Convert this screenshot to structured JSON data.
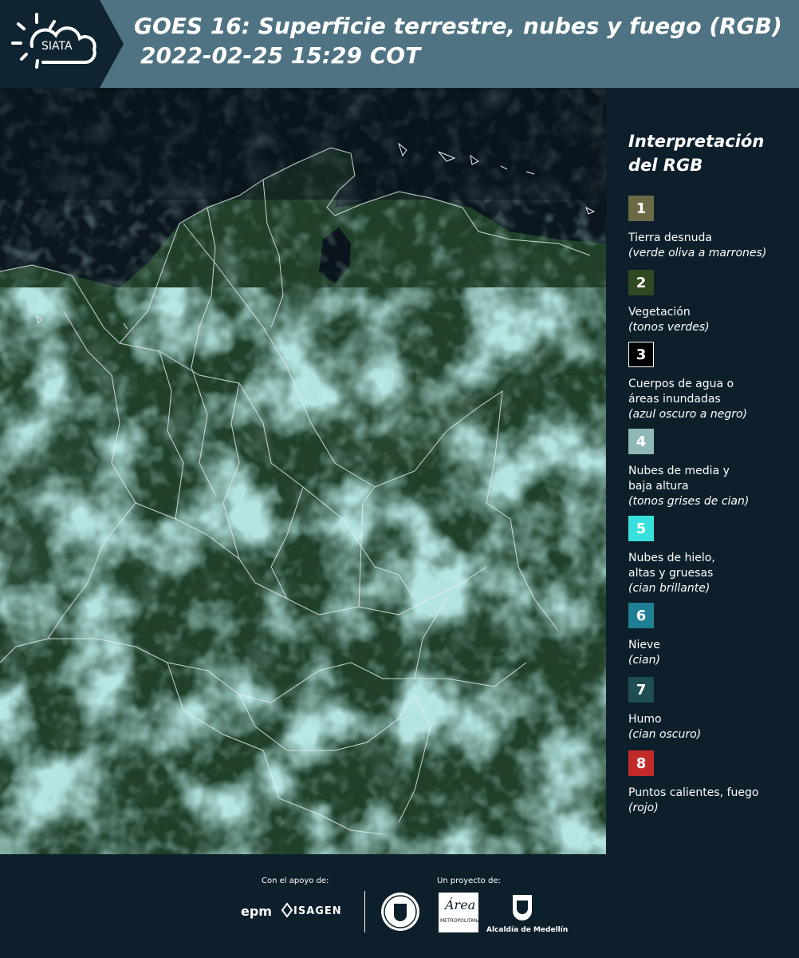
{
  "header": {
    "logo_text": "SIATA",
    "title_line1": "GOES 16: Superficie terrestre, nubes y fuego (RGB)",
    "title_line2": "2022-02-25 15:29 COT",
    "background_color": "#4f7382"
  },
  "legend": {
    "title_line1": "Interpretación",
    "title_line2": "del RGB",
    "items": [
      {
        "number": "1",
        "color": "#6b6a46",
        "label": "Tierra desnuda",
        "note": "(verde oliva a marrones)"
      },
      {
        "number": "2",
        "color": "#2f4a22",
        "label": "Vegetación",
        "note": "(tonos verdes)"
      },
      {
        "number": "3",
        "color": "#000000",
        "label": "Cuerpos de agua o áreas inundadas",
        "note": "(azul oscuro a negro)"
      },
      {
        "number": "4",
        "color": "#8fb8b6",
        "label": "Nubes de media y baja altura",
        "note": "(tonos grises de cian)"
      },
      {
        "number": "5",
        "color": "#37e0dc",
        "label": "Nubes de hielo, altas y gruesas",
        "note": "(cian brillante)"
      },
      {
        "number": "6",
        "color": "#1f7f94",
        "label": "Nieve",
        "note": "(cian)"
      },
      {
        "number": "7",
        "color": "#1e4e52",
        "label": "Humo",
        "note": "(cian oscuro)"
      },
      {
        "number": "8",
        "color": "#c22b2a",
        "label": "Puntos calientes, fuego",
        "note": "(rojo)"
      }
    ]
  },
  "footer": {
    "support_label": "Con el apoyo de:",
    "project_label": "Un proyecto de:",
    "sponsor_1": "epm",
    "sponsor_2": "ISAGEN",
    "partner_area": "Área",
    "partner_area_sub": "METROPOLITANA",
    "partner_alcaldia": "Alcaldía de Medellín"
  }
}
